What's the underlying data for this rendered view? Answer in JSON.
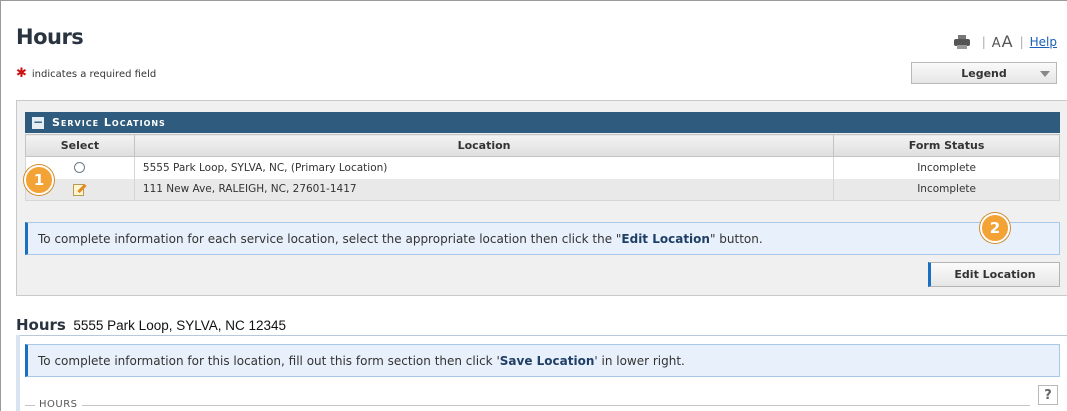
{
  "page": {
    "title": "Hours",
    "required_note": "indicates a required field",
    "required_star": "✱"
  },
  "tools": {
    "print_icon": "printer-icon",
    "font_small": "A",
    "font_big": "A",
    "help_label": "Help"
  },
  "legend": {
    "label": "Legend"
  },
  "service_locations": {
    "collapse_label": "−",
    "title": "Service Locations",
    "columns": [
      "Select",
      "Location",
      "Form Status"
    ],
    "rows": [
      {
        "select": "radio",
        "location": "5555 Park Loop, SYLVA, NC,  (Primary Location)",
        "status": "Incomplete"
      },
      {
        "select": "edit-icon",
        "location": "111 New Ave, RALEIGH, NC, 27601-1417",
        "status": "Incomplete"
      }
    ],
    "info_pre": "To complete information for each service location, select the appropriate location then click the \"",
    "info_bold": "Edit Location",
    "info_post": "\" button.",
    "edit_button": "Edit Location"
  },
  "markers": {
    "m1": "1",
    "m2": "2"
  },
  "hours_form": {
    "heading_label": "Hours",
    "heading_address": "5555 Park Loop, SYLVA, NC 12345",
    "info_pre": "To complete information for this location, fill out this form section then click '",
    "info_bold": "Save Location",
    "info_post": "' in lower right.",
    "help_mark": "?",
    "fieldset_label": "HOURS"
  },
  "colors": {
    "section_bar": "#2f5b7e",
    "info_bg": "#e8f1fb",
    "accent_blue": "#1b6fc2",
    "marker_orange": "#f3a236",
    "required_red": "#cc1111"
  }
}
